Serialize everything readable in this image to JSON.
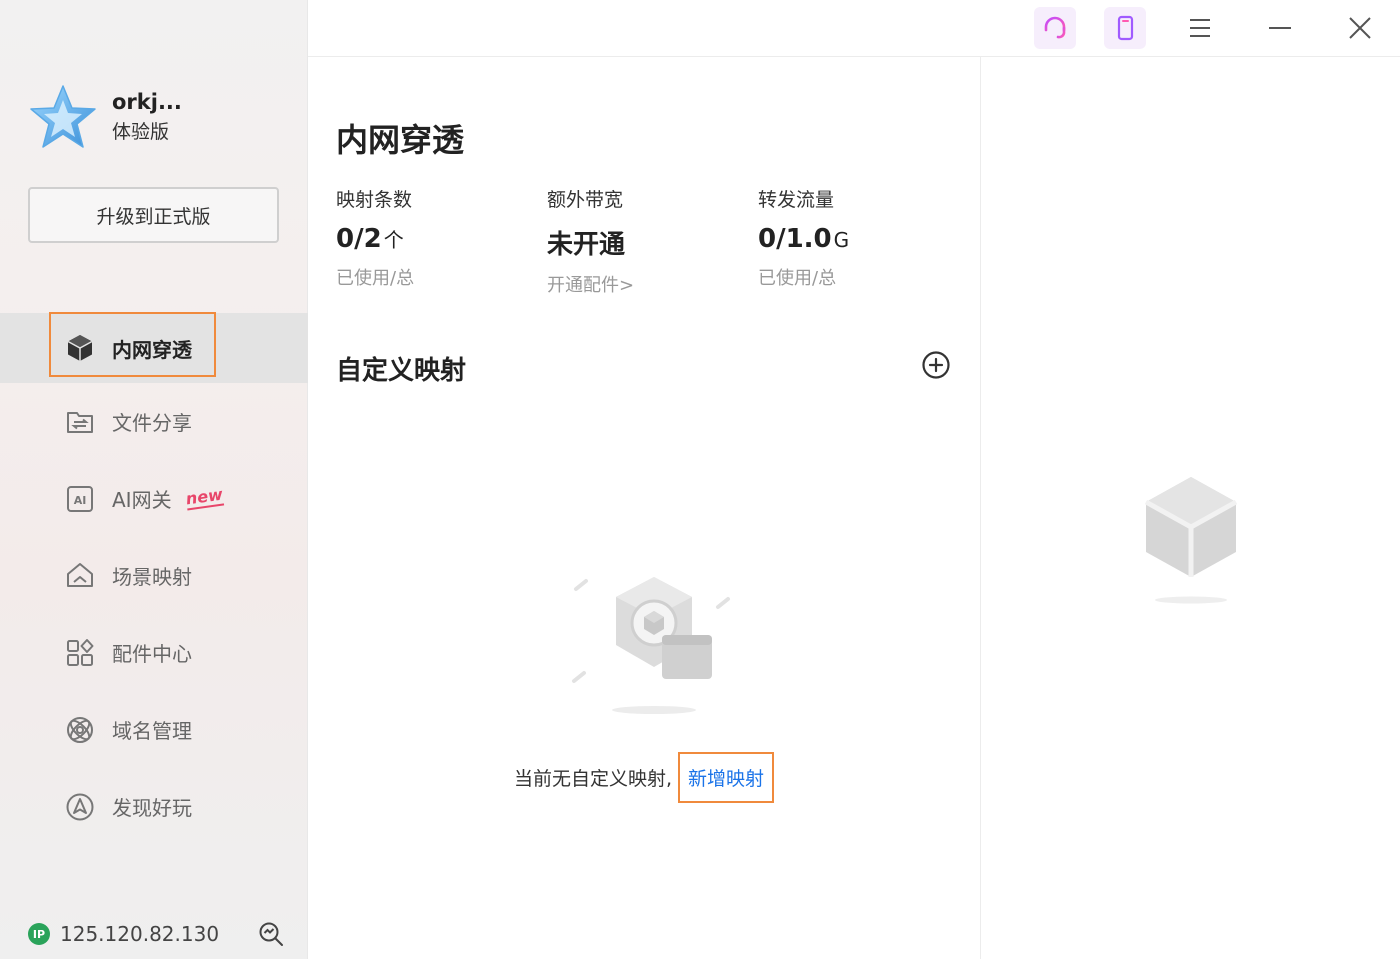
{
  "profile": {
    "username": "orkj...",
    "plan": "体验版",
    "upgrade_label": "升级到正式版"
  },
  "nav": {
    "items": [
      {
        "label": "内网穿透",
        "icon": "cube-icon",
        "active": true
      },
      {
        "label": "文件分享",
        "icon": "folder-share-icon"
      },
      {
        "label": "AI网关",
        "icon": "ai-icon",
        "badge": "new"
      },
      {
        "label": "场景映射",
        "icon": "home-scene-icon"
      },
      {
        "label": "配件中心",
        "icon": "apps-grid-icon"
      },
      {
        "label": "域名管理",
        "icon": "domain-globe-icon"
      },
      {
        "label": "发现好玩",
        "icon": "compass-icon"
      }
    ]
  },
  "footer": {
    "ip_badge": "IP",
    "ip_address": "125.120.82.130",
    "icon": "search-zoom-icon"
  },
  "topbar": {
    "icons": [
      "headset-icon",
      "phone-icon",
      "menu-icon",
      "minimize-icon",
      "close-icon"
    ]
  },
  "main": {
    "title": "内网穿透",
    "stats": [
      {
        "label": "映射条数",
        "value": "0/2",
        "unit": "个",
        "sub": "已使用/总"
      },
      {
        "label": "额外带宽",
        "value": "未开通",
        "unit": "",
        "sub": "开通配件>"
      },
      {
        "label": "转发流量",
        "value": "0/1.0",
        "unit": "G",
        "sub": "已使用/总"
      }
    ],
    "section_title": "自定义映射",
    "empty_text": "当前无自定义映射,",
    "add_link": "新增映射"
  },
  "colors": {
    "accent_highlight": "#f08a3c",
    "link": "#1a73e8",
    "ip_badge": "#2aa35a",
    "new_badge": "#e8466a"
  }
}
